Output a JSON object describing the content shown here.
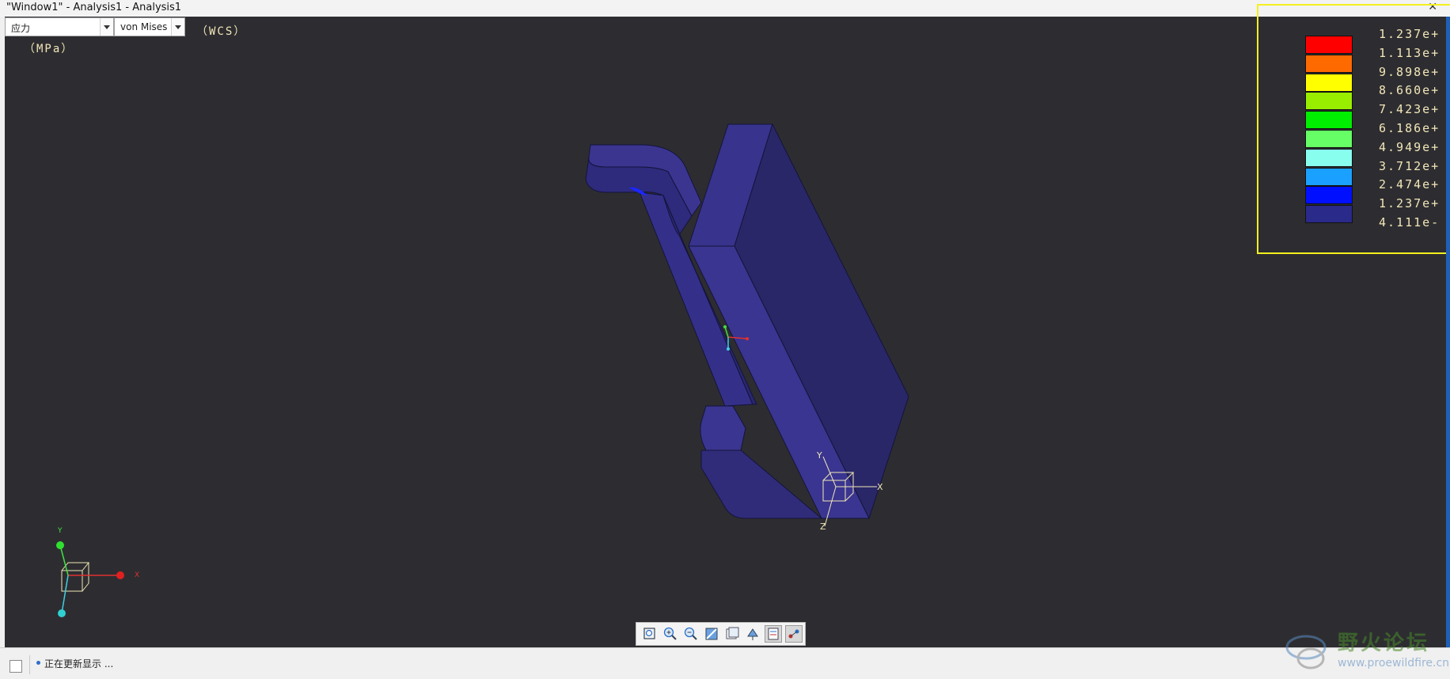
{
  "window": {
    "title": "\"Window1\" - Analysis1 - Analysis1",
    "close_glyph": "✕"
  },
  "controls": {
    "quantity_value": "应力",
    "component_value": "von Mises",
    "coordinate_system": "（WCS）",
    "units": "（MPa）"
  },
  "legend": {
    "items": [
      {
        "label": "1.237e+",
        "color": "#ff0000"
      },
      {
        "label": "1.113e+",
        "color": "#ff6a00"
      },
      {
        "label": "9.898e+",
        "color": "#ffff00"
      },
      {
        "label": "8.660e+",
        "color": "#99ee00"
      },
      {
        "label": "7.423e+",
        "color": "#00ee00"
      },
      {
        "label": "6.186e+",
        "color": "#66ff66"
      },
      {
        "label": "4.949e+",
        "color": "#88ffee"
      },
      {
        "label": "3.712e+",
        "color": "#1aa0ff"
      },
      {
        "label": "2.474e+",
        "color": "#0010ff"
      },
      {
        "label": "1.237e+",
        "color": "#2a2a8a"
      },
      {
        "label": "4.111e-",
        "color": null
      }
    ]
  },
  "triad_labels": {
    "x": "X",
    "y": "Y",
    "z": "Z"
  },
  "toolbar": {
    "buttons": [
      "refit-icon",
      "zoom-in-icon",
      "zoom-out-icon",
      "repaint-icon",
      "saved-views-icon",
      "orientation-icon",
      "display-style-icon",
      "spin-center-icon"
    ]
  },
  "status": {
    "message": "正在更新显示 ..."
  },
  "watermark": {
    "title": "野火论坛",
    "url": "www.proewildfire.cn"
  }
}
